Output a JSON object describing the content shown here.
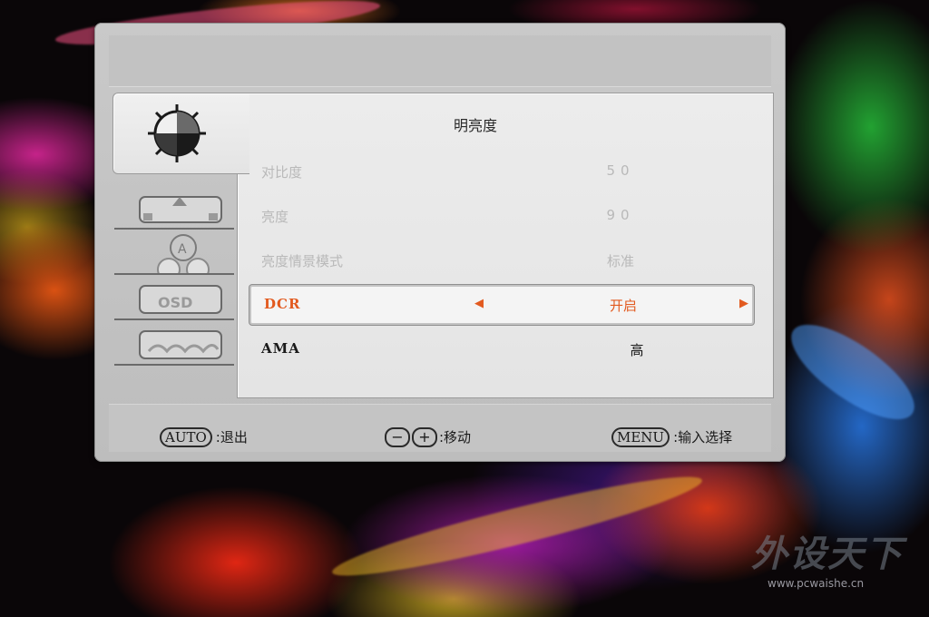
{
  "menu": {
    "title": "明亮度",
    "items": [
      {
        "label": "对比度",
        "value": "50",
        "state": "disabled"
      },
      {
        "label": "亮度",
        "value": "90",
        "state": "disabled"
      },
      {
        "label": "亮度情景模式",
        "value": "标准",
        "state": "disabled"
      },
      {
        "label": "DCR",
        "value": "开启",
        "state": "selected"
      },
      {
        "label": "AMA",
        "value": "高",
        "state": "normal"
      }
    ]
  },
  "sidebar": {
    "tabs": [
      {
        "icon": "brightness-icon",
        "active": true
      },
      {
        "icon": "image-setup-icon",
        "active": false
      },
      {
        "icon": "color-setup-icon",
        "active": false
      },
      {
        "icon": "osd-setup-icon",
        "active": false
      },
      {
        "icon": "extra-icon",
        "active": false
      }
    ]
  },
  "footer": {
    "auto_key": "AUTO",
    "auto_action": ":退出",
    "minus_key": "−",
    "plus_key": "+",
    "move_action": ":移动",
    "menu_key": "MENU",
    "menu_action": ":输入选择"
  },
  "watermark": {
    "logo": "外设天下",
    "url": "www.pcwaishe.cn"
  },
  "colors": {
    "accent": "#e25a1f",
    "panel": "#c9c9c9",
    "content": "#e8e8e8",
    "disabled_text": "#b9b9b9"
  }
}
